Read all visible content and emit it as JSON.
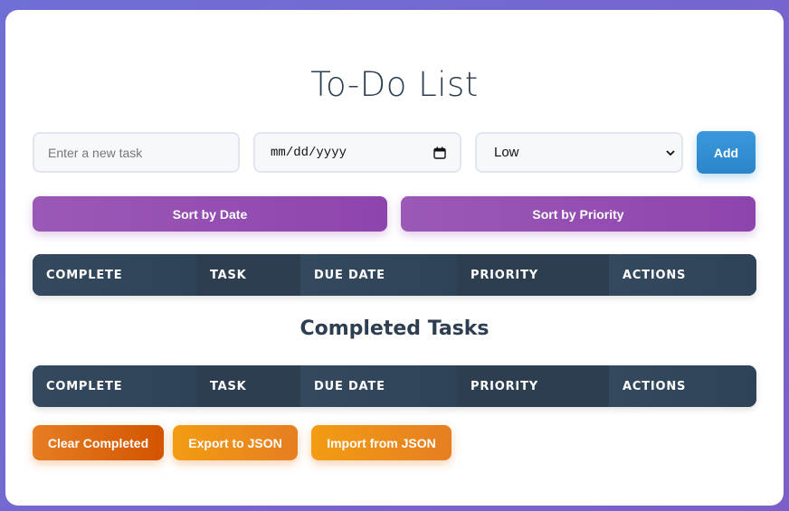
{
  "header": {
    "title": "To-Do List"
  },
  "form": {
    "task_placeholder": "Enter a new task",
    "date_placeholder": "mm/dd/yyyy",
    "priority_selected": "Low",
    "add_label": "Add"
  },
  "sort": {
    "by_date_label": "Sort by Date",
    "by_priority_label": "Sort by Priority"
  },
  "tasks_table": {
    "columns": [
      "COMPLETE",
      "TASK",
      "DUE DATE",
      "PRIORITY",
      "ACTIONS"
    ]
  },
  "completed": {
    "heading": "Completed Tasks",
    "columns": [
      "COMPLETE",
      "TASK",
      "DUE DATE",
      "PRIORITY",
      "ACTIONS"
    ]
  },
  "actions": {
    "clear_label": "Clear Completed",
    "export_label": "Export to JSON",
    "import_label": "Import from JSON"
  },
  "colors": {
    "add_button": "#3498db",
    "sort_buttons": "#9b59b6",
    "table_header": "#34495e",
    "clear_button": "#e67e22",
    "export_import_buttons": "#f39c12"
  },
  "icons": {
    "date_picker": "calendar-icon",
    "select": "chevron-down-icon"
  }
}
